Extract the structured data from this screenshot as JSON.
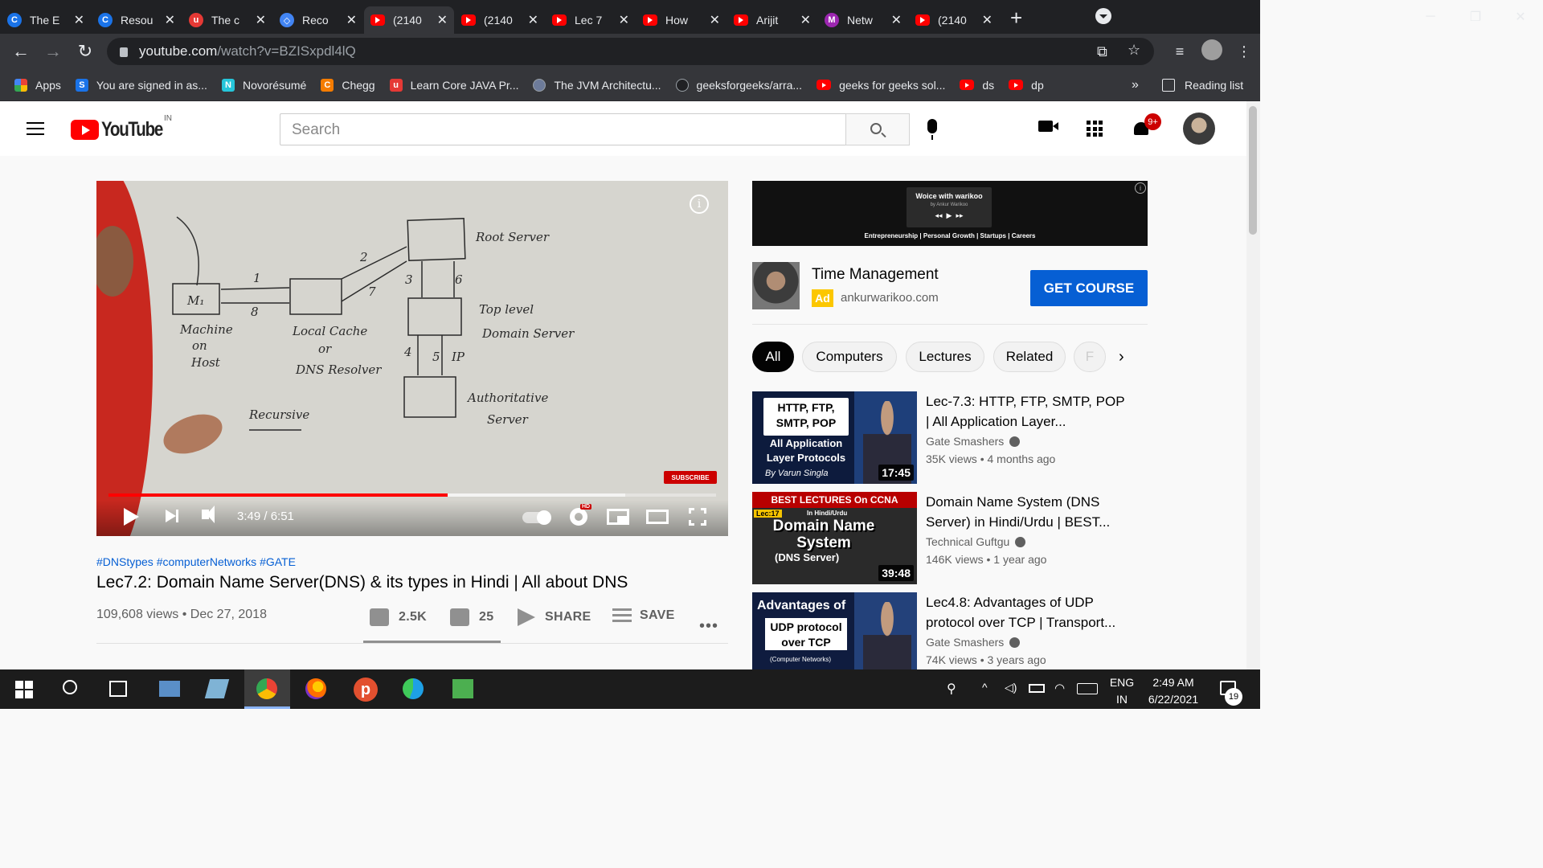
{
  "browser": {
    "tabs": [
      {
        "title": "The E",
        "favicon": "C",
        "color": "#1a73e8"
      },
      {
        "title": "Resou",
        "favicon": "C",
        "color": "#1a73e8"
      },
      {
        "title": "The c",
        "favicon": "u",
        "color": "#e53935"
      },
      {
        "title": "Reco",
        "favicon": "◇",
        "color": "#4285f4"
      },
      {
        "title": "(2140",
        "favicon": "yt",
        "color": "#ff0000"
      },
      {
        "title": "(2140",
        "favicon": "yt",
        "color": "#ff0000"
      },
      {
        "title": "Lec 7",
        "favicon": "yt",
        "color": "#ff0000"
      },
      {
        "title": "How",
        "favicon": "yt",
        "color": "#ff0000"
      },
      {
        "title": "Arijit",
        "favicon": "yt",
        "color": "#ff0000"
      },
      {
        "title": "Netw",
        "favicon": "M",
        "color": "#9c27b0"
      },
      {
        "title": "(2140",
        "favicon": "yt",
        "color": "#ff0000"
      }
    ],
    "active_tab_index": 4,
    "url_host": "youtube.com",
    "url_path": "/watch?v=BZISxpdl4lQ",
    "bookmarks": [
      {
        "label": "Apps",
        "icon": "apps-grid",
        "color": "#ea4335"
      },
      {
        "label": "You are signed in as...",
        "icon": "S",
        "color": "#1a73e8"
      },
      {
        "label": "Novorésumé",
        "icon": "N",
        "color": "#26c6da"
      },
      {
        "label": "Chegg",
        "icon": "C",
        "color": "#f57c00"
      },
      {
        "label": "Learn Core JAVA Pr...",
        "icon": "u",
        "color": "#e53935"
      },
      {
        "label": "The JVM Architectu...",
        "icon": "hex",
        "color": "#6d7b9a"
      },
      {
        "label": "geeksforgeeks/arra...",
        "icon": "github",
        "color": "#202124"
      },
      {
        "label": "geeks for geeks sol...",
        "icon": "yt",
        "color": "#ff0000"
      },
      {
        "label": "ds",
        "icon": "yt",
        "color": "#ff0000"
      },
      {
        "label": "dp",
        "icon": "yt",
        "color": "#ff0000"
      }
    ],
    "bookmarks_more": "»",
    "reading_list": "Reading list"
  },
  "youtube": {
    "logo_text": "YouTube",
    "country_code": "IN",
    "search_placeholder": "Search",
    "notification_badge": "9+"
  },
  "player": {
    "time": "3:49 / 6:51",
    "played_fraction": 0.5576,
    "buffered_fraction": 0.85,
    "hd_badge": "HD",
    "subscribe_badge": "SUBSCRIBE",
    "info_glyph": "i",
    "whiteboard": {
      "m1": "M₁",
      "labels": [
        "Machine",
        "on",
        "Host",
        "Local Cache",
        "or",
        "DNS Resolver",
        "Root Server",
        "Top level",
        "Domain Server",
        "Authoritative",
        "Server",
        "Recursive",
        "1",
        "2",
        "3",
        "4",
        "5",
        "IP",
        "6",
        "7",
        "8"
      ]
    }
  },
  "video": {
    "hashtags": "#DNStypes #computerNetworks #GATE",
    "title": "Lec7.2: Domain Name Server(DNS) & its types in Hindi | All about DNS",
    "meta": "109,608 views • Dec 27, 2018",
    "like_count": "2.5K",
    "dislike_count": "25",
    "share_label": "SHARE",
    "save_label": "SAVE",
    "more_label": "•••"
  },
  "ad": {
    "banner_title": "Woice with warikoo",
    "banner_subtitle": "by Ankur Warikoo",
    "banner_tagline": "Entrepreneurship | Personal Growth | Startups | Careers",
    "title": "Time Management",
    "tag": "Ad",
    "domain": "ankurwarikoo.com",
    "cta": "GET COURSE"
  },
  "chips": [
    "All",
    "Computers",
    "Lectures",
    "Related",
    "F"
  ],
  "recommendations": [
    {
      "title": "Lec-7.3: HTTP, FTP, SMTP, POP | All Application Layer...",
      "channel": "Gate Smashers",
      "meta": "35K views • 4 months ago",
      "duration": "17:45",
      "thumb_box": "HTTP, FTP, SMTP, POP",
      "thumb_sub": "All Application Layer Protocols",
      "thumb_by": "By Varun Singla"
    },
    {
      "title": "Domain Name System (DNS Server) in Hindi/Urdu | BEST...",
      "channel": "Technical Guftgu",
      "meta": "146K views • 1 year ago",
      "duration": "39:48",
      "thumb_banner": "BEST LECTURES On CCNA",
      "thumb_lec": "Lec:17",
      "thumb_urdu": "In Hindi/Urdu",
      "thumb_big": "Domain Name System",
      "thumb_dns": "(DNS Server)"
    },
    {
      "title": "Lec4.8: Advantages of UDP protocol over TCP | Transport...",
      "channel": "Gate Smashers",
      "meta": "74K views • 3 years ago",
      "duration": "",
      "thumb_line1": "Advantages of",
      "thumb_box": "UDP protocol over TCP",
      "thumb_cn": "(Computer Networks)"
    }
  ],
  "taskbar": {
    "lang_line1": "ENG",
    "lang_line2": "IN",
    "time": "2:49 AM",
    "date": "6/22/2021",
    "notifications": "19"
  }
}
